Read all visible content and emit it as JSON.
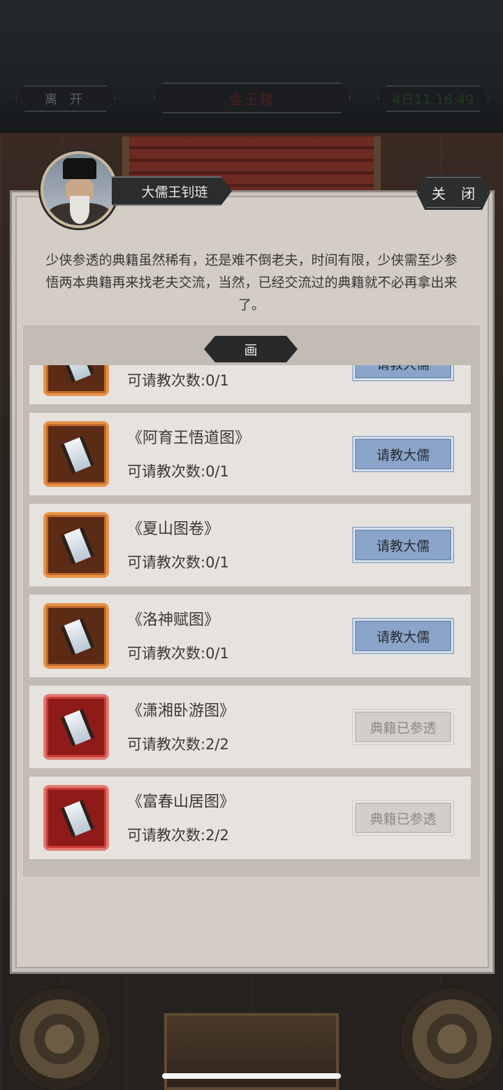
{
  "topbar": {
    "leave_label": "离 开",
    "location": "金玉楼",
    "time": "4日11:16:49"
  },
  "dialog": {
    "npc_name": "大儒王钊琏",
    "close_label": "关 闭",
    "description": "少侠参透的典籍虽然稀有，还是难不倒老夫，时间有限，少侠需至少参悟两本典籍再来找老夫交流，当然，已经交流过的典籍就不必再拿出来了。",
    "category_tab": "画"
  },
  "items": [
    {
      "name": "",
      "count": "可请教次数:0/1",
      "button": "请教大儒",
      "status": "available",
      "rarity": "orange"
    },
    {
      "name": "《阿育王悟道图》",
      "count": "可请教次数:0/1",
      "button": "请教大儒",
      "status": "available",
      "rarity": "orange"
    },
    {
      "name": "《夏山图卷》",
      "count": "可请教次数:0/1",
      "button": "请教大儒",
      "status": "available",
      "rarity": "orange"
    },
    {
      "name": "《洛神赋图》",
      "count": "可请教次数:0/1",
      "button": "请教大儒",
      "status": "available",
      "rarity": "orange"
    },
    {
      "name": "《潇湘卧游图》",
      "count": "可请教次数:2/2",
      "button": "典籍已参透",
      "status": "done",
      "rarity": "red"
    },
    {
      "name": "《富春山居图》",
      "count": "可请教次数:2/2",
      "button": "典籍已参透",
      "status": "done",
      "rarity": "red"
    }
  ],
  "icons": {
    "item": "painting-scroll-icon"
  }
}
